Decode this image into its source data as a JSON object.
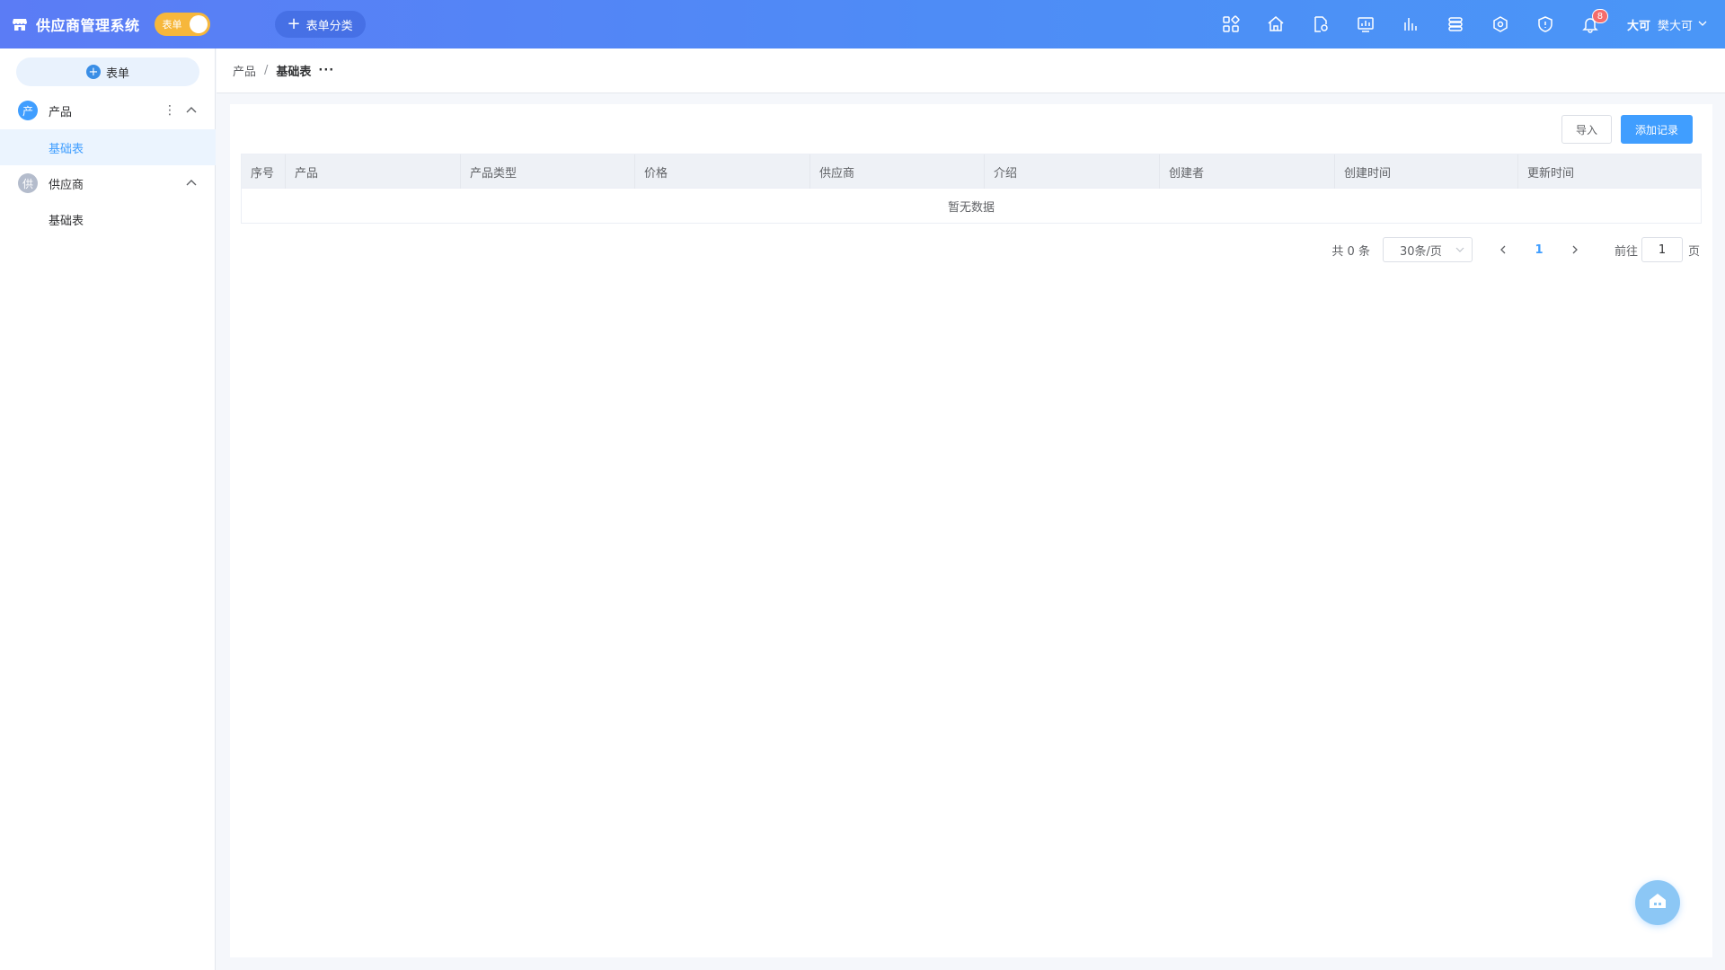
{
  "header": {
    "title": "供应商管理系统",
    "mode_toggle_label": "表单",
    "category_button_label": "表单分类",
    "icons": [
      "apps-icon",
      "home-icon",
      "document-settings-icon",
      "dashboard-icon",
      "chart-icon",
      "storage-icon",
      "network-icon",
      "shield-icon",
      "bell-icon"
    ],
    "notification_count": "8",
    "user": {
      "avatar_text": "大可",
      "name": "樊大可"
    }
  },
  "sidebar": {
    "new_form_label": "表单",
    "groups": [
      {
        "avatar": "产",
        "label": "产品",
        "color": "#409eff",
        "items": [
          {
            "label": "基础表",
            "active": true
          }
        ]
      },
      {
        "avatar": "供",
        "label": "供应商",
        "color": "#b4bccc",
        "items": [
          {
            "label": "基础表",
            "active": false
          }
        ]
      }
    ]
  },
  "breadcrumb": {
    "parent": "产品",
    "separator": "/",
    "current": "基础表",
    "more": "···"
  },
  "toolbar": {
    "import_label": "导入",
    "add_label": "添加记录"
  },
  "table": {
    "columns": [
      "序号",
      "产品",
      "产品类型",
      "价格",
      "供应商",
      "介绍",
      "创建者",
      "创建时间",
      "更新时间"
    ],
    "empty_text": "暂无数据"
  },
  "pagination": {
    "total_text": "共 0 条",
    "page_size": "30条/页",
    "current_page": "1",
    "goto_label": "前往",
    "goto_value": "1",
    "unit_label": "页"
  },
  "colors": {
    "primary": "#409eff",
    "header_gradient_start": "#5b7cf5",
    "toggle": "#f6b73c",
    "badge": "#f56c6c"
  }
}
